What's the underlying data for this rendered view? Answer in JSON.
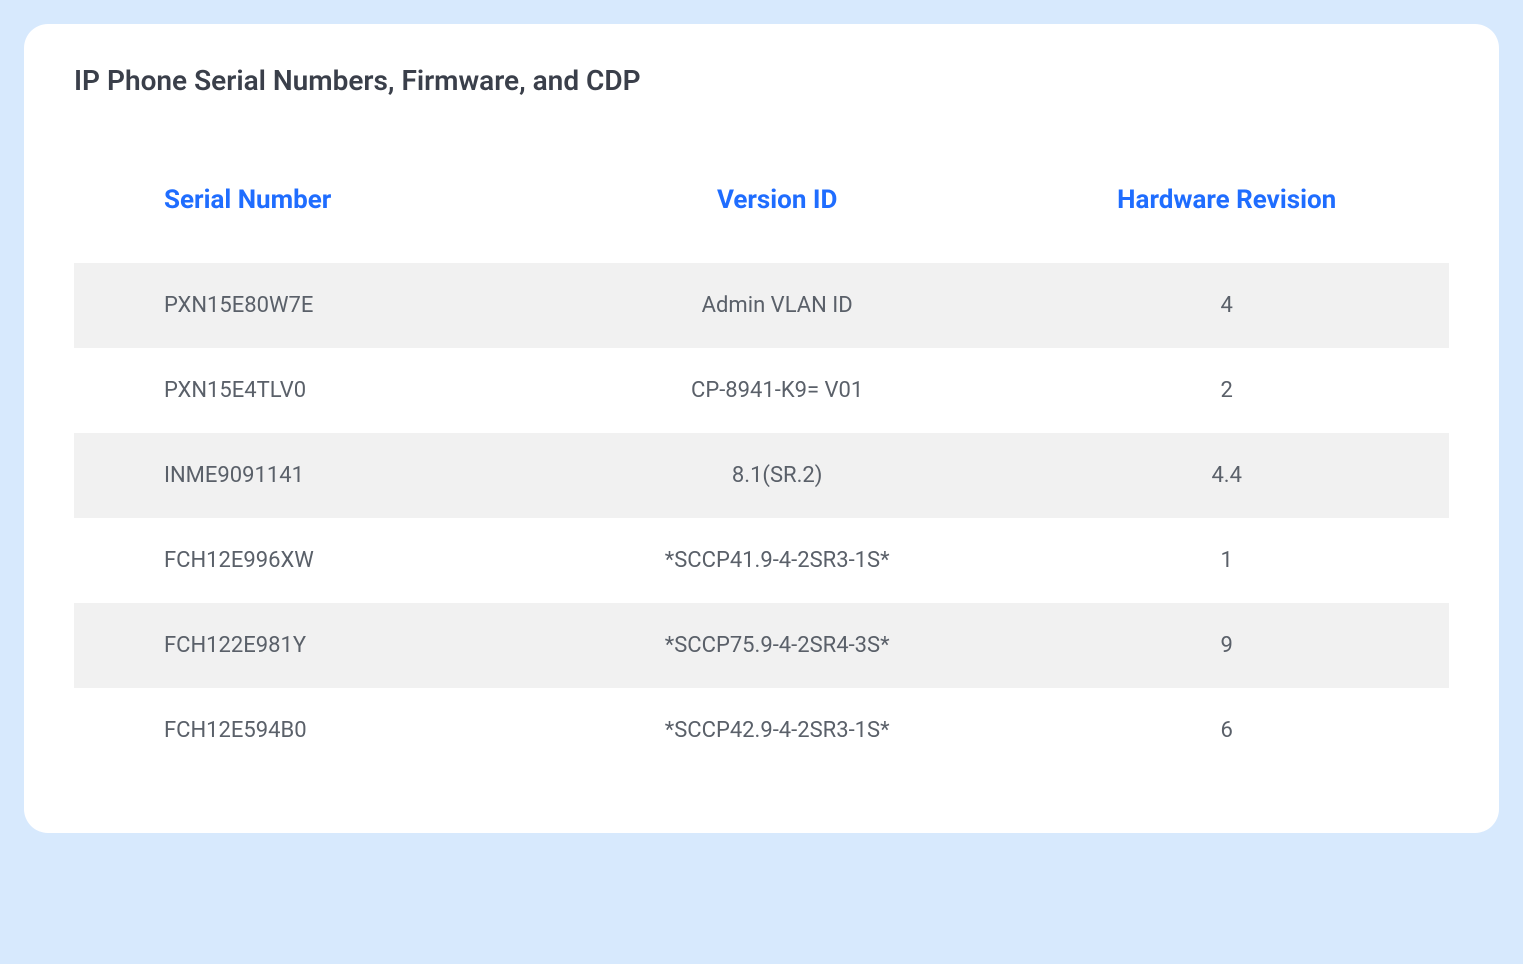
{
  "title": "IP Phone Serial Numbers, Firmware, and CDP",
  "headers": {
    "col1": "Serial Number",
    "col2": "Version ID",
    "col3": "Hardware Revision"
  },
  "rows": [
    {
      "serial": "PXN15E80W7E",
      "version": "Admin VLAN ID",
      "revision": "4"
    },
    {
      "serial": "PXN15E4TLV0",
      "version": "CP-8941-K9= V01",
      "revision": "2"
    },
    {
      "serial": "INME9091141",
      "version": "8.1(SR.2)",
      "revision": "4.4"
    },
    {
      "serial": "FCH12E996XW",
      "version": "*SCCP41.9-4-2SR3-1S*",
      "revision": "1"
    },
    {
      "serial": "FCH122E981Y",
      "version": "*SCCP75.9-4-2SR4-3S*",
      "revision": "9"
    },
    {
      "serial": "FCH12E594B0",
      "version": "*SCCP42.9-4-2SR3-1S*",
      "revision": "6"
    }
  ]
}
